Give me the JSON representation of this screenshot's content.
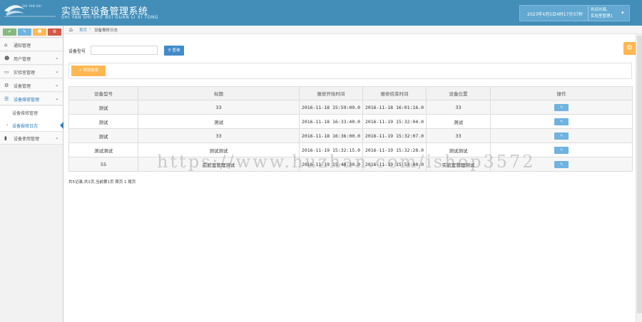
{
  "header": {
    "logo_small": "SHI YAN SHI",
    "title": "实验室设备管理系统",
    "subtitle": "SHI YAN SHI SHE BEI GUAN LI XI TONG",
    "datetime": "2023年4月5日4时17分37秒",
    "welcome": "欢迎光临,",
    "username": "实验室管理1"
  },
  "shortcuts": [
    {
      "icon": "check-icon",
      "color": "#87b87f"
    },
    {
      "icon": "pencil-icon",
      "color": "#6fb3e0"
    },
    {
      "icon": "users-icon",
      "color": "#ffb752"
    },
    {
      "icon": "cogs-icon",
      "color": "#d15b47"
    }
  ],
  "sidebar": {
    "items": [
      {
        "label": "通知管理",
        "icon": "home-icon"
      },
      {
        "label": "用户管理",
        "icon": "users-icon"
      },
      {
        "label": "实验室管理",
        "icon": "desktop-icon"
      },
      {
        "label": "设备管理",
        "icon": "cogs-icon"
      },
      {
        "label": "设备维修管理",
        "icon": "list-icon"
      },
      {
        "label": "设备使用管理",
        "icon": "bookmark-icon"
      }
    ],
    "submenu": [
      {
        "label": "设备维修管理"
      },
      {
        "label": "设备报修日志"
      }
    ]
  },
  "breadcrumb": {
    "home": "首页",
    "current": "设备报修日志"
  },
  "search": {
    "label": "设备型号",
    "value": "",
    "placeholder": "",
    "button": "查询"
  },
  "toolbar": {
    "add_label": "+ 添加信息"
  },
  "table": {
    "columns": [
      "设备型号",
      "标题",
      "报修开始时间",
      "报修结束时间",
      "设备位置",
      "操作"
    ],
    "rows": [
      [
        "测试",
        "33",
        "2016-11-18 15:59:09.0",
        "2016-11-18 16:01:16.0",
        "33"
      ],
      [
        "测试",
        "测试",
        "2016-11-18 16:33:40.0",
        "2016-11-19 15:32:04.0",
        "测试"
      ],
      [
        "测试",
        "33",
        "2016-11-18 16:36:00.0",
        "2016-11-19 15:32:07.0",
        "33"
      ],
      [
        "测试测试",
        "测试测试",
        "2016-11-19 15:32:15.0",
        "2016-11-19 15:32:28.0",
        "测试测试"
      ],
      [
        "55",
        "实验室管理测试",
        "2016-11-19 15:48:30.0",
        "2016-11-19 15:53:40.0",
        "实验室管理测试"
      ]
    ]
  },
  "pager": "共5记录,共1页,当前第1页 首页 1 尾页",
  "watermark": "https://www.huzhan.com/ishop3572"
}
